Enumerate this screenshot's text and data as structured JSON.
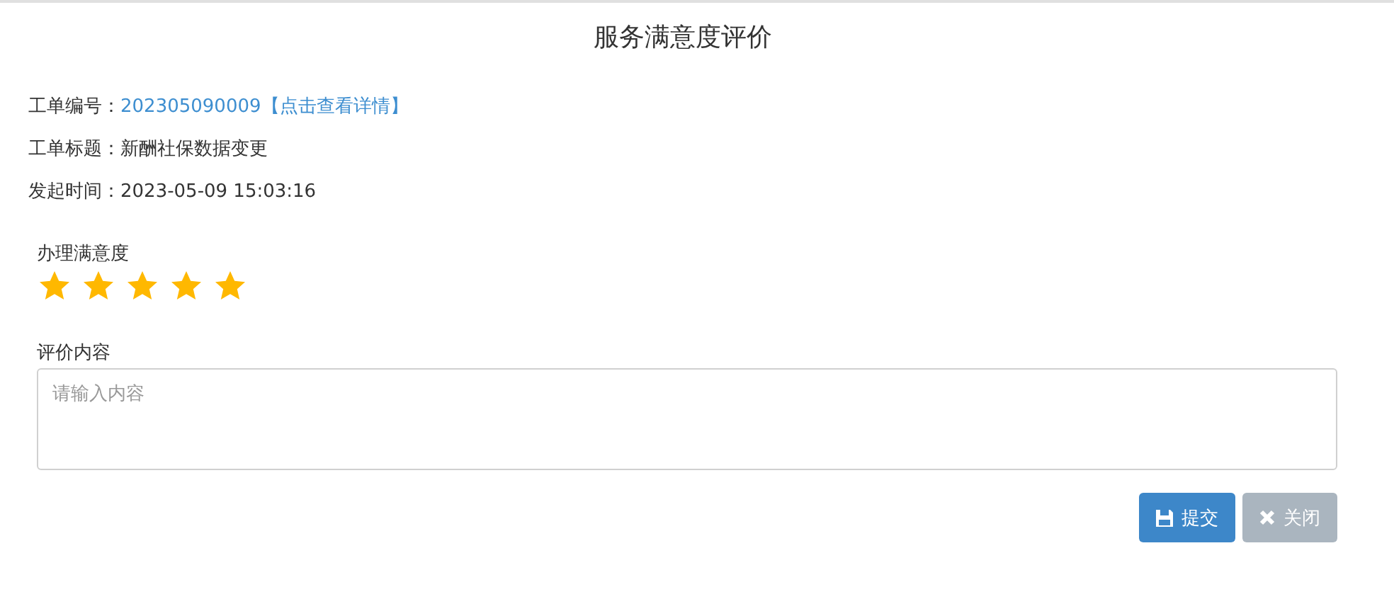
{
  "title": "服务满意度评价",
  "info": [
    {
      "label": "工单编号：",
      "value": "202305090009",
      "link": "【点击查看详情】"
    },
    {
      "label": "工单标题：",
      "value": "新酬社保数据变更"
    },
    {
      "label": "发起时间：",
      "value": "2023-05-09 15:03:16"
    }
  ],
  "rating": {
    "label": "办理满意度",
    "stars": 5
  },
  "comment": {
    "label": "评价内容",
    "placeholder": "请输入内容"
  },
  "buttons": [
    {
      "kind": "save",
      "label": "提交"
    },
    {
      "kind": "close",
      "label": "关闭"
    }
  ]
}
